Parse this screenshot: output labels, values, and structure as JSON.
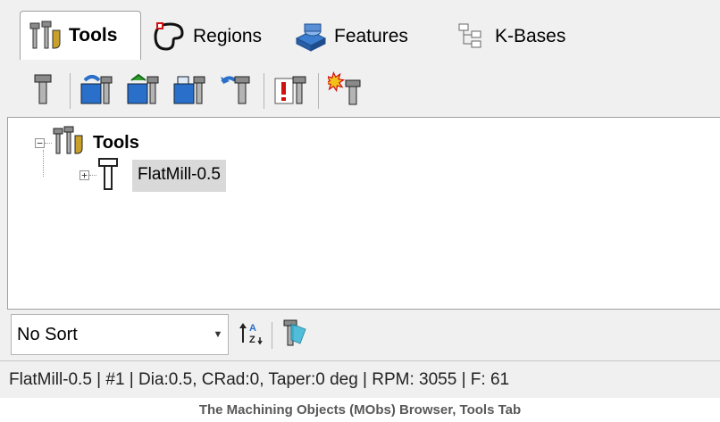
{
  "tabs": [
    {
      "label": "Tools",
      "icon": "tools-tab-icon",
      "active": true
    },
    {
      "label": "Regions",
      "icon": "regions-tab-icon",
      "active": false
    },
    {
      "label": "Features",
      "icon": "features-tab-icon",
      "active": false
    },
    {
      "label": "K-Bases",
      "icon": "kbases-tab-icon",
      "active": false
    }
  ],
  "toolbar": {
    "icons": [
      "create-tool-icon",
      "load-tool-icon",
      "save-tool-icon",
      "save-as-tool-icon",
      "undo-tool-icon",
      "tool-properties-icon",
      "delete-tool-icon"
    ]
  },
  "tree": {
    "root_label": "Tools",
    "root_expander": "−",
    "child_label": "FlatMill-0.5",
    "child_expander": "+"
  },
  "sort": {
    "value": "No Sort",
    "arrow": "▼",
    "sort_icon": "sort-az-icon",
    "filter_icon": "filter-tool-icon"
  },
  "status": {
    "text": "FlatMill-0.5 | #1 | Dia:0.5, CRad:0, Taper:0 deg | RPM: 3055 | F: 61"
  },
  "caption": "The Machining Objects (MObs) Browser, Tools Tab",
  "colors": {
    "panel": "#f0f0f0",
    "tool_body": "#6e6e6e",
    "accent_blue": "#2a6fc9",
    "accent_red": "#d01010",
    "selection": "#d9d9d9"
  }
}
